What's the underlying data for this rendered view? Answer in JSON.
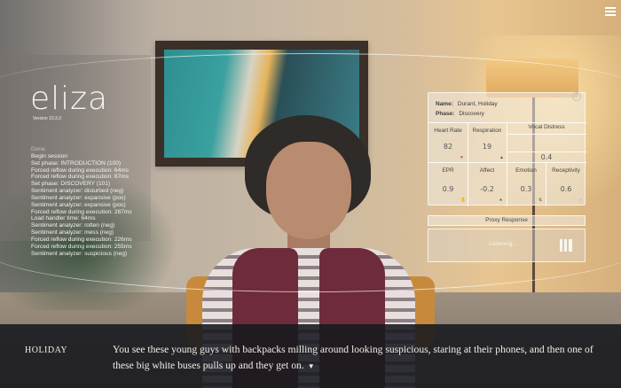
{
  "app": {
    "logo": "eliza",
    "version": "Version 10.3.3"
  },
  "log": [
    {
      "text": "Done.",
      "dim": true
    },
    {
      "text": "Begin session",
      "dim": false
    },
    {
      "text": "Set phase: INTRODUCTION (100)",
      "dim": false
    },
    {
      "text": "Forced reflow during execution: 64ms",
      "dim": false
    },
    {
      "text": "Forced reflow during execution: 67ms",
      "dim": false
    },
    {
      "text": "Set phase: DISCOVERY (101)",
      "dim": false
    },
    {
      "text": "Sentiment analyzer: disturbed (neg)",
      "dim": false
    },
    {
      "text": "Sentiment analyzer: expansive (pos)",
      "dim": false
    },
    {
      "text": "Sentiment analyzer: expansive (pos)",
      "dim": false
    },
    {
      "text": "Forced reflow during execution: 287ms",
      "dim": false
    },
    {
      "text": "Load handler time: 64ms",
      "dim": false
    },
    {
      "text": "Sentiment analyzer: rotten (neg)",
      "dim": false
    },
    {
      "text": "Sentiment analyzer: mess (neg)",
      "dim": false
    },
    {
      "text": "Forced reflow during execution: 226ms",
      "dim": false
    },
    {
      "text": "Forced reflow during execution: 255ms",
      "dim": false
    },
    {
      "text": "Sentiment analyzer: suspicious (neg)",
      "dim": false
    }
  ],
  "client": {
    "name_label": "Name:",
    "name": "Durant, Holiday",
    "phase_label": "Phase:",
    "phase": "Discovery"
  },
  "vitals": {
    "heart_rate_label": "Heart Rate",
    "heart_rate": "82",
    "respiration_label": "Respiration",
    "respiration": "19",
    "vocal_distress_label": "Vocal Distress",
    "vocal_distress": "0.4",
    "epr_label": "EPR",
    "epr": "0.9",
    "affect_label": "Affect",
    "affect": "-0.2",
    "emotion_label": "Emotion",
    "emotion": "0.3",
    "receptivity_label": "Receptivity",
    "receptivity": "0.6"
  },
  "proxy": {
    "title": "Proxy Response",
    "status": "Listening..."
  },
  "dialogue": {
    "speaker": "HOLIDAY",
    "text": "You see these young guys with backpacks milling around looking suspicious, staring at their phones, and then one of these big white buses pulls up and they get on."
  },
  "icons": {
    "menu": "hamburger-menu-icon",
    "advance": "triangle-down-icon",
    "settings": "gear-icon",
    "proxy": "grid-icon"
  },
  "colors": {
    "dialogue_bg": "#16181e",
    "hud_text": "#f2f2f2",
    "vest": "#6e2b3b"
  }
}
